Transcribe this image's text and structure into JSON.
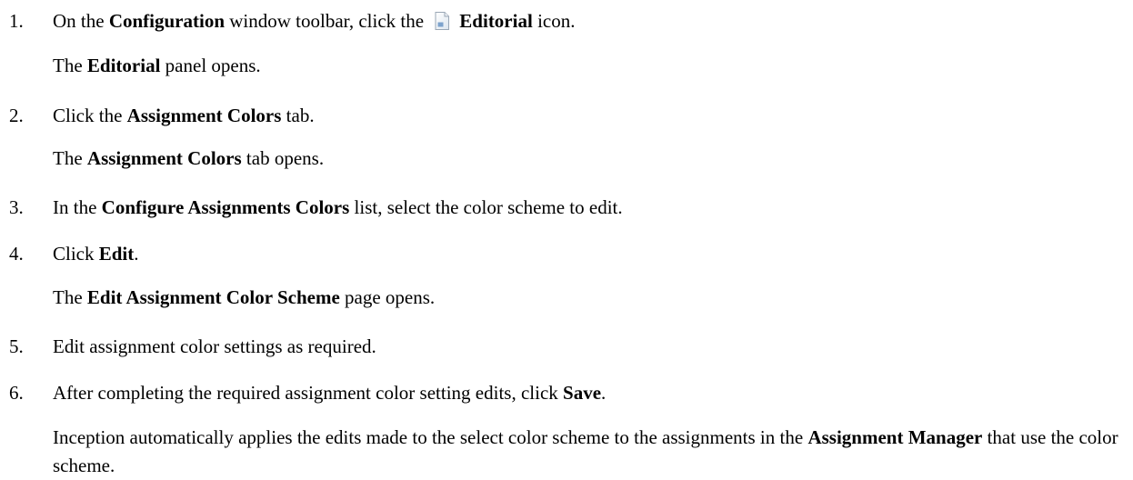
{
  "steps": [
    {
      "number": "1.",
      "parts": [
        "On the ",
        "Configuration",
        " window toolbar, click the ",
        "Editorial",
        " icon."
      ],
      "icon": "document-icon",
      "result": [
        "The ",
        "Editorial",
        " panel opens."
      ]
    },
    {
      "number": "2.",
      "parts": [
        "Click the ",
        "Assignment Colors",
        " tab."
      ],
      "result": [
        "The ",
        "Assignment Colors",
        " tab opens."
      ]
    },
    {
      "number": "3.",
      "parts": [
        "In the ",
        "Configure Assignments Colors",
        " list, select the color scheme to edit."
      ]
    },
    {
      "number": "4.",
      "parts": [
        "Click ",
        "Edit",
        "."
      ],
      "result": [
        "The ",
        "Edit Assignment Color Scheme",
        " page opens."
      ]
    },
    {
      "number": "5.",
      "parts": [
        "Edit assignment color settings as required."
      ]
    },
    {
      "number": "6.",
      "parts": [
        "After completing the required assignment color setting edits, click ",
        "Save",
        "."
      ],
      "result": [
        "Inception automatically applies the edits made to the select color scheme to the assignments in the ",
        "Assignment Manager",
        " that use the color scheme."
      ]
    }
  ]
}
